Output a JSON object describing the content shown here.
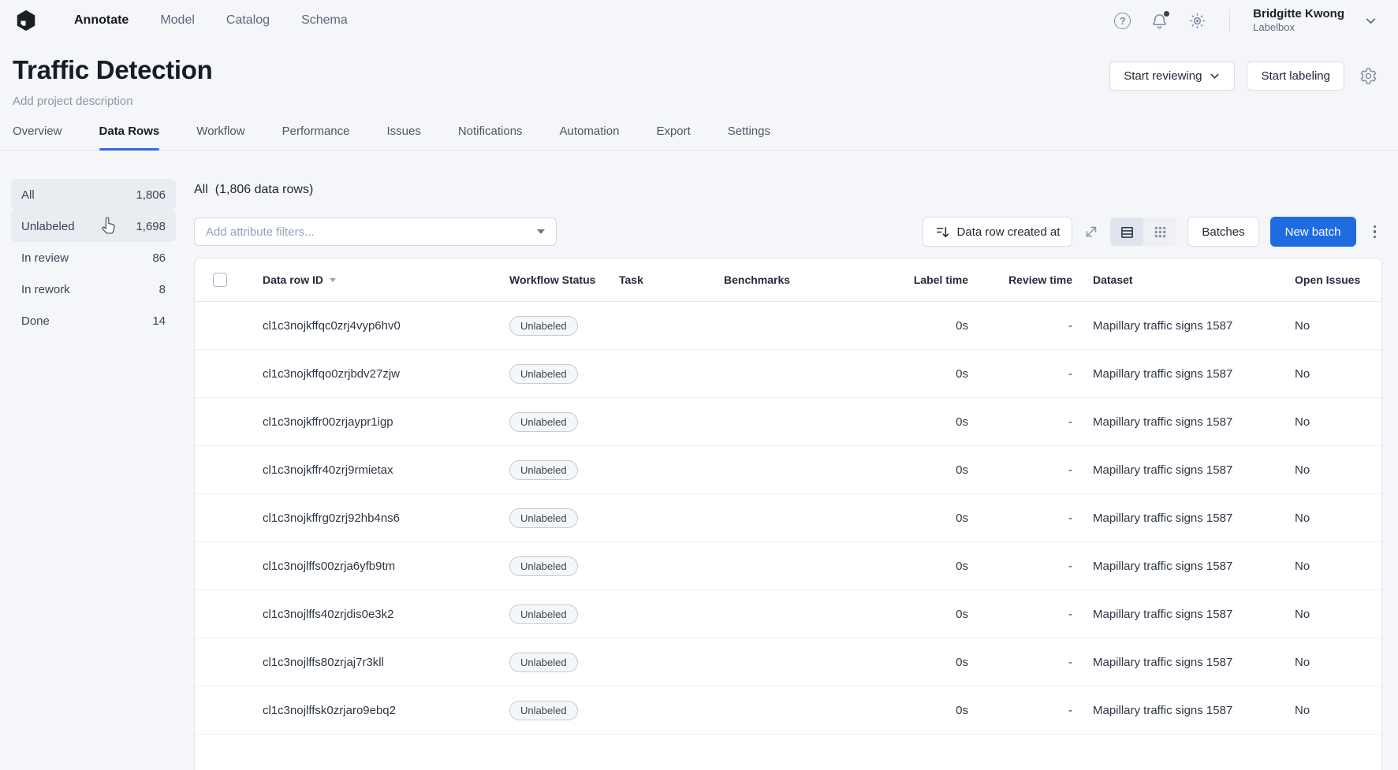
{
  "topnav": {
    "items": [
      {
        "label": "Annotate",
        "active": true
      },
      {
        "label": "Model",
        "active": false
      },
      {
        "label": "Catalog",
        "active": false
      },
      {
        "label": "Schema",
        "active": false
      }
    ],
    "user": {
      "name": "Bridgitte Kwong",
      "org": "Labelbox"
    }
  },
  "header": {
    "title": "Traffic Detection",
    "description_placeholder": "Add project description",
    "start_reviewing_label": "Start reviewing",
    "start_labeling_label": "Start labeling"
  },
  "tabs": [
    {
      "label": "Overview"
    },
    {
      "label": "Data Rows",
      "active": true
    },
    {
      "label": "Workflow"
    },
    {
      "label": "Performance"
    },
    {
      "label": "Issues"
    },
    {
      "label": "Notifications"
    },
    {
      "label": "Automation"
    },
    {
      "label": "Export"
    },
    {
      "label": "Settings"
    }
  ],
  "sidebar": {
    "items": [
      {
        "label": "All",
        "count": "1,806",
        "highlighted": true
      },
      {
        "label": "Unlabeled",
        "count": "1,698",
        "highlighted": true
      },
      {
        "label": "In review",
        "count": "86",
        "highlighted": false
      },
      {
        "label": "In rework",
        "count": "8",
        "highlighted": false
      },
      {
        "label": "Done",
        "count": "14",
        "highlighted": false
      }
    ]
  },
  "toolbar": {
    "heading_label": "All",
    "heading_detail": "(1,806 data rows)",
    "filter_placeholder": "Add attribute filters...",
    "sort_label": "Data row created at",
    "batches_label": "Batches",
    "new_batch_label": "New batch"
  },
  "table": {
    "columns": [
      "Data row ID",
      "Workflow Status",
      "Task",
      "Benchmarks",
      "Label time",
      "Review time",
      "Dataset",
      "Open Issues"
    ],
    "rows": [
      {
        "id": "cl1c3nojkffqc0zrj4vyp6hv0",
        "status": "Unlabeled",
        "task": "",
        "benchmarks": "",
        "label_time": "0s",
        "review_time": "-",
        "dataset": "Mapillary traffic signs 1587",
        "open_issues": "No"
      },
      {
        "id": "cl1c3nojkffqo0zrjbdv27zjw",
        "status": "Unlabeled",
        "task": "",
        "benchmarks": "",
        "label_time": "0s",
        "review_time": "-",
        "dataset": "Mapillary traffic signs 1587",
        "open_issues": "No"
      },
      {
        "id": "cl1c3nojkffr00zrjaypr1igp",
        "status": "Unlabeled",
        "task": "",
        "benchmarks": "",
        "label_time": "0s",
        "review_time": "-",
        "dataset": "Mapillary traffic signs 1587",
        "open_issues": "No"
      },
      {
        "id": "cl1c3nojkffr40zrj9rmietax",
        "status": "Unlabeled",
        "task": "",
        "benchmarks": "",
        "label_time": "0s",
        "review_time": "-",
        "dataset": "Mapillary traffic signs 1587",
        "open_issues": "No"
      },
      {
        "id": "cl1c3nojkffrg0zrj92hb4ns6",
        "status": "Unlabeled",
        "task": "",
        "benchmarks": "",
        "label_time": "0s",
        "review_time": "-",
        "dataset": "Mapillary traffic signs 1587",
        "open_issues": "No"
      },
      {
        "id": "cl1c3nojlffs00zrja6yfb9tm",
        "status": "Unlabeled",
        "task": "",
        "benchmarks": "",
        "label_time": "0s",
        "review_time": "-",
        "dataset": "Mapillary traffic signs 1587",
        "open_issues": "No"
      },
      {
        "id": "cl1c3nojlffs40zrjdis0e3k2",
        "status": "Unlabeled",
        "task": "",
        "benchmarks": "",
        "label_time": "0s",
        "review_time": "-",
        "dataset": "Mapillary traffic signs 1587",
        "open_issues": "No"
      },
      {
        "id": "cl1c3nojlffs80zrjaj7r3kll",
        "status": "Unlabeled",
        "task": "",
        "benchmarks": "",
        "label_time": "0s",
        "review_time": "-",
        "dataset": "Mapillary traffic signs 1587",
        "open_issues": "No"
      },
      {
        "id": "cl1c3nojlffsk0zrjaro9ebq2",
        "status": "Unlabeled",
        "task": "",
        "benchmarks": "",
        "label_time": "0s",
        "review_time": "-",
        "dataset": "Mapillary traffic signs 1587",
        "open_issues": "No"
      }
    ]
  },
  "icons": {
    "help_glyph": "?",
    "logo": "labelbox-cube",
    "help": "question-circle",
    "notifications": "bell-with-dot",
    "theme": "sun-brightness",
    "user_menu": "chevron-down",
    "settings": "gear",
    "sort": "sort-lines-down-arrow",
    "expand": "diagonal-resize-arrows",
    "list_view": "list-rows",
    "grid_view": "grid-dots",
    "more": "kebab-vertical",
    "filter_dropdown": "triangle-down",
    "column_sort": "triangle-down",
    "cursor": "hand-pointer"
  },
  "colors": {
    "accent_blue": "#2f6be2",
    "new_batch_blue": "#1f6ce0",
    "page_background": "#f5f6f9",
    "sidebar_highlight": "#e9ecf1"
  }
}
